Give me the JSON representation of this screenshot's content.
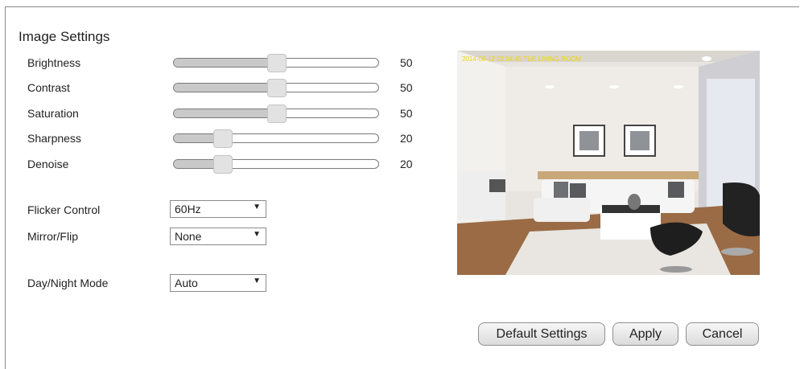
{
  "section_title": "Image Settings",
  "sliders": [
    {
      "label": "Brightness",
      "value": "50",
      "level": 50
    },
    {
      "label": "Contrast",
      "value": "50",
      "level": 50
    },
    {
      "label": "Saturation",
      "value": "50",
      "level": 50
    },
    {
      "label": "Sharpness",
      "value": "20",
      "level": 20
    },
    {
      "label": "Denoise",
      "value": "20",
      "level": 20
    }
  ],
  "selects": [
    {
      "label": "Flicker Control",
      "value": "60Hz"
    },
    {
      "label": "Mirror/Flip",
      "value": "None"
    },
    {
      "label": "Day/Night Mode",
      "value": "Auto"
    }
  ],
  "preview": {
    "osd_text": "2014-08-12 02:04:45 TUE  LIVING ROOM"
  },
  "buttons": {
    "default": "Default Settings",
    "apply": "Apply",
    "cancel": "Cancel"
  }
}
